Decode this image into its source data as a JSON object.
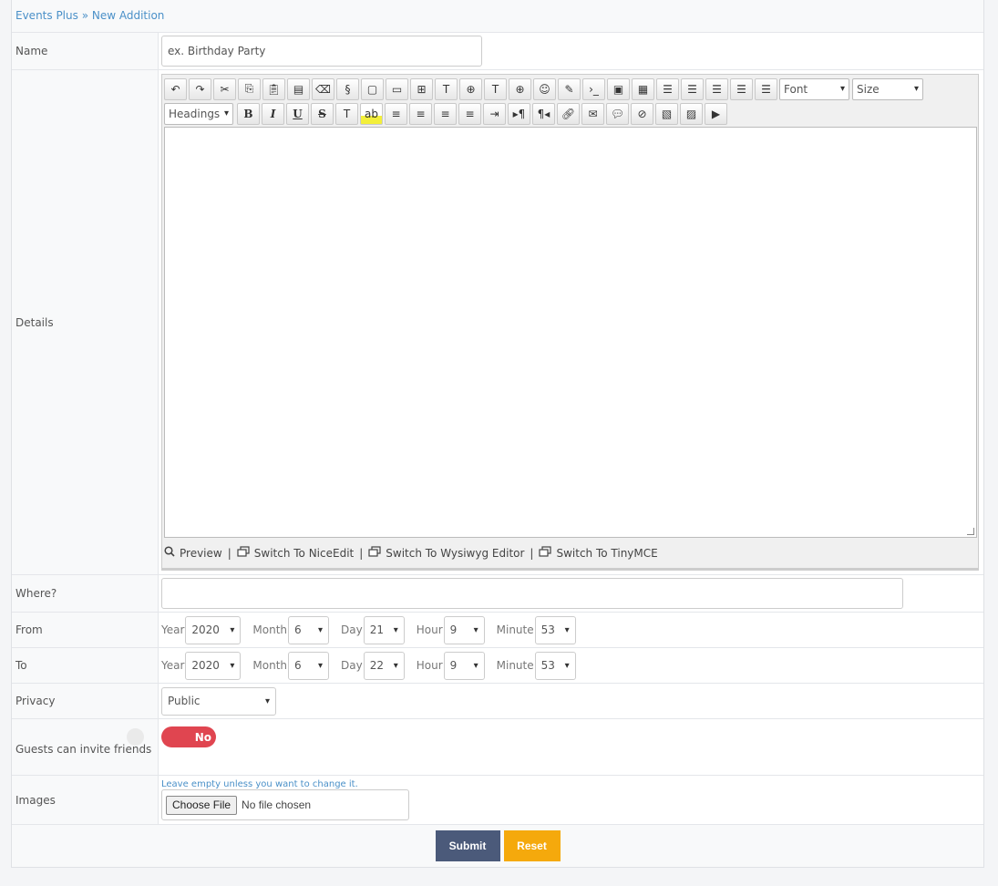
{
  "breadcrumb": {
    "root": "Events Plus",
    "sep": "»",
    "current": "New Addition"
  },
  "form": {
    "name_label": "Name",
    "name_placeholder": "ex. Birthday Party",
    "details_label": "Details",
    "where_label": "Where?",
    "from_label": "From",
    "to_label": "To",
    "privacy_label": "Privacy",
    "guests_label": "Guests can invite friends",
    "images_label": "Images"
  },
  "editor": {
    "font_select": "Font",
    "size_select": "Size",
    "headings_select": "Headings",
    "bold": "B",
    "italic": "I",
    "underline": "U",
    "strike": "S",
    "preview": "Preview",
    "switch_niceedit": "Switch To NiceEdit",
    "switch_wysiwyg": "Switch To Wysiwyg Editor",
    "switch_tinymce": "Switch To TinyMCE",
    "separator": "|"
  },
  "date_labels": {
    "year": "Year",
    "month": "Month",
    "day": "Day",
    "hour": "Hour",
    "minute": "Minute"
  },
  "from": {
    "year": "2020",
    "month": "6",
    "day": "21",
    "hour": "9",
    "minute": "53"
  },
  "to": {
    "year": "2020",
    "month": "6",
    "day": "22",
    "hour": "9",
    "minute": "53"
  },
  "privacy": {
    "value": "Public"
  },
  "guests_toggle": {
    "value": "No",
    "color": "#e04550"
  },
  "images": {
    "help": "Leave empty unless you want to change it.",
    "button": "Choose File",
    "status": "No file chosen"
  },
  "actions": {
    "submit": "Submit",
    "submit_color": "#4b5a7a",
    "reset": "Reset",
    "reset_color": "#f5a90c"
  }
}
